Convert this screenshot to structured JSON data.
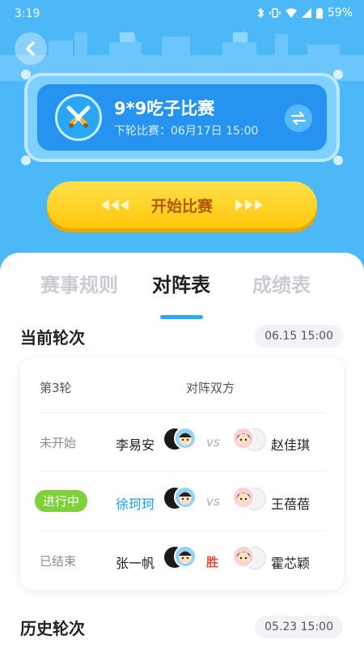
{
  "status_bar": {
    "time": "3:19",
    "battery": "59%"
  },
  "game": {
    "title": "9*9吃子比赛",
    "next_round": "下轮比赛：06月17日 15:00"
  },
  "start_button": {
    "label": "开始比赛"
  },
  "tabs": [
    {
      "label": "赛事规则",
      "active": false
    },
    {
      "label": "对阵表",
      "active": true
    },
    {
      "label": "成绩表",
      "active": false
    }
  ],
  "current_round": {
    "title": "当前轮次",
    "date": "06.15 15:00",
    "round_label": "第3轮",
    "pairs_label": "对阵双方",
    "matches": [
      {
        "status": "未开始",
        "player1": "李易安",
        "result": "vs",
        "player2": "赵佳琪"
      },
      {
        "status": "进行中",
        "player1": "徐珂珂",
        "result": "vs",
        "player2": "王蓓蓓"
      },
      {
        "status": "已结束",
        "player1": "张一帆",
        "result": "胜",
        "player2": "霍芯颖"
      }
    ]
  },
  "history_round": {
    "title": "历史轮次",
    "date": "05.23 15:00"
  },
  "colors": {
    "hero_blue": "#4db8f7",
    "accent_blue": "#2aa9f5",
    "live_green": "#7ed13a",
    "win_red": "#e54b3c",
    "button_yellow": "#ffc60a"
  }
}
